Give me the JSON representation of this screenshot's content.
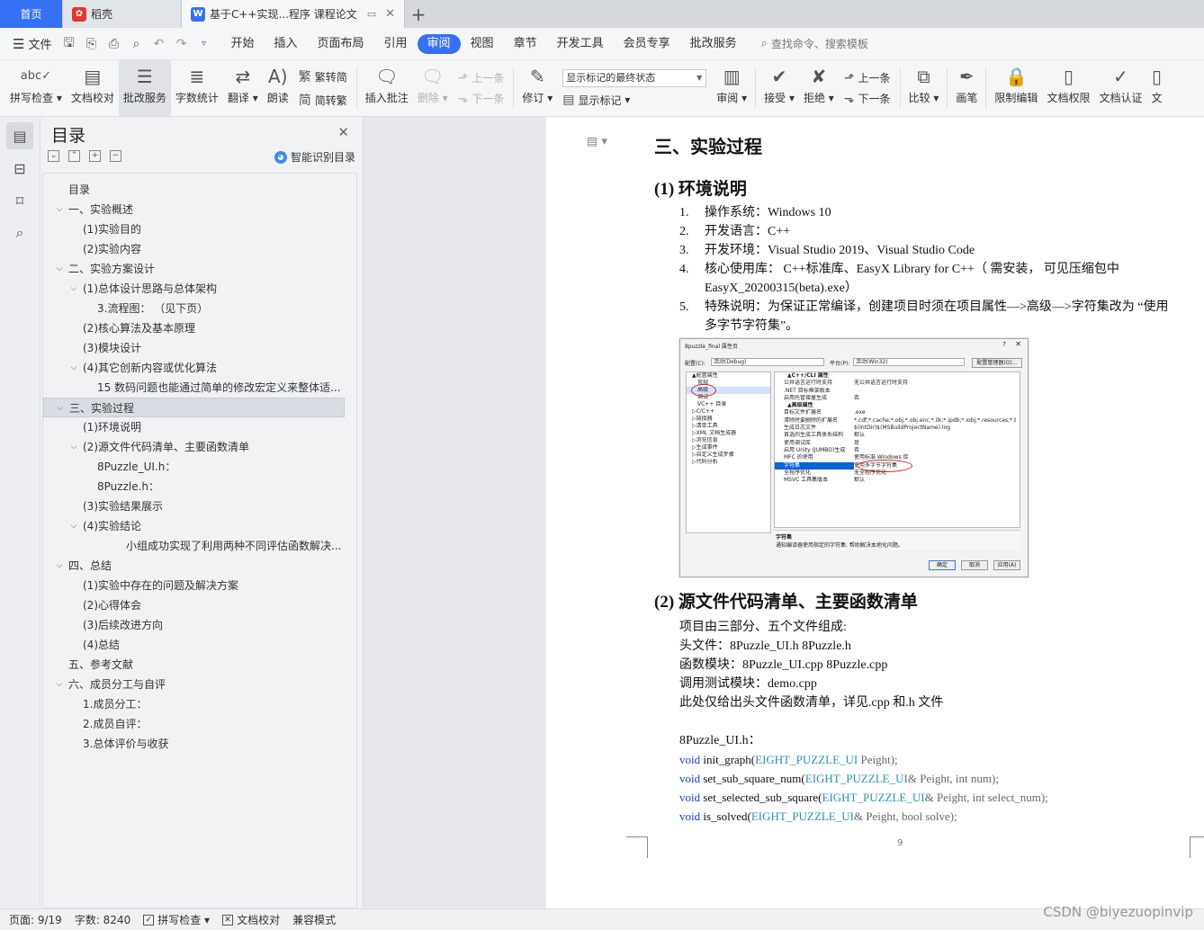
{
  "tabs": {
    "home": "首页",
    "daoke": "稻壳",
    "doc": "基于C++实现...程序 课程论文"
  },
  "menu": {
    "file": "文件",
    "tabs": [
      "开始",
      "插入",
      "页面布局",
      "引用",
      "审阅",
      "视图",
      "章节",
      "开发工具",
      "会员专享",
      "批改服务"
    ],
    "active_tab": "审阅",
    "search": "查找命令、搜索模板"
  },
  "ribbon": {
    "spell": "拼写检查",
    "doccheck": "文档校对",
    "correct": "批改服务",
    "wordcount": "字数统计",
    "translate": "翻译",
    "read": "朗读",
    "trad": "繁转简",
    "simp": "简转繁",
    "insert_comment": "插入批注",
    "delete": "删除",
    "prev": "上一条",
    "next": "下一条",
    "revise": "修订",
    "markup_state": "显示标记的最终状态",
    "show_markup": "显示标记",
    "review": "审阅",
    "accept": "接受",
    "reject": "拒绝",
    "prev2": "上一条",
    "next2": "下一条",
    "compare": "比较",
    "pen": "画笔",
    "restrict": "限制编辑",
    "rights": "文档权限",
    "auth": "文档认证",
    "more": "文"
  },
  "toc": {
    "title": "目录",
    "smart": "智能识别目录",
    "items": [
      {
        "text": "目录",
        "level": 0,
        "chev": ""
      },
      {
        "text": "一、实验概述",
        "level": 0,
        "chev": "v"
      },
      {
        "text": "(1)实验目的",
        "level": 1,
        "chev": ""
      },
      {
        "text": "(2)实验内容",
        "level": 1,
        "chev": ""
      },
      {
        "text": "二、实验方案设计",
        "level": 0,
        "chev": "v"
      },
      {
        "text": "(1)总体设计思路与总体架构",
        "level": 1,
        "chev": "v"
      },
      {
        "text": "3.流程图： （见下页）",
        "level": 2,
        "chev": ""
      },
      {
        "text": "(2)核心算法及基本原理",
        "level": 1,
        "chev": ""
      },
      {
        "text": "(3)模块设计",
        "level": 1,
        "chev": ""
      },
      {
        "text": "(4)其它创新内容或优化算法",
        "level": 1,
        "chev": "v"
      },
      {
        "text": "15 数码问题也能通过简单的修改宏定义来整体适...",
        "level": 2,
        "chev": ""
      },
      {
        "text": "三、实验过程",
        "level": 0,
        "chev": "v",
        "hl": true
      },
      {
        "text": "(1)环境说明",
        "level": 1,
        "chev": ""
      },
      {
        "text": "(2)源文件代码清单、主要函数清单",
        "level": 1,
        "chev": "v"
      },
      {
        "text": "8Puzzle_UI.h：",
        "level": 2,
        "chev": ""
      },
      {
        "text": "8Puzzle.h：",
        "level": 2,
        "chev": ""
      },
      {
        "text": "(3)实验结果展示",
        "level": 1,
        "chev": ""
      },
      {
        "text": "(4)实验结论",
        "level": 1,
        "chev": "v"
      },
      {
        "text": "小组成功实现了利用两种不同评估函数解决...",
        "level": 3,
        "chev": ""
      },
      {
        "text": "四、总结",
        "level": 0,
        "chev": "v"
      },
      {
        "text": "(1)实验中存在的问题及解决方案",
        "level": 1,
        "chev": ""
      },
      {
        "text": "(2)心得体会",
        "level": 1,
        "chev": ""
      },
      {
        "text": "(3)后续改进方向",
        "level": 1,
        "chev": ""
      },
      {
        "text": "(4)总结",
        "level": 1,
        "chev": ""
      },
      {
        "text": "五、参考文献",
        "level": 0,
        "chev": ""
      },
      {
        "text": "六、成员分工与自评",
        "level": 0,
        "chev": "v"
      },
      {
        "text": "1.成员分工：",
        "level": 1,
        "chev": ""
      },
      {
        "text": "2.成员自评：",
        "level": 1,
        "chev": ""
      },
      {
        "text": "3.总体评价与收获",
        "level": 1,
        "chev": ""
      }
    ]
  },
  "doc": {
    "h1": "三、实验过程",
    "h2a": "(1)  环境说明",
    "env": [
      {
        "n": "1.",
        "t": "操作系统：Windows 10"
      },
      {
        "n": "2.",
        "t": "开发语言：C++"
      },
      {
        "n": "3.",
        "t": "开发环境：Visual Studio 2019、Visual Studio Code"
      },
      {
        "n": "4.",
        "t": "核心使用库： C++标准库、EasyX Library for C++（ 需安装， 可见压缩包中 EasyX_20200315(beta).exe）"
      },
      {
        "n": "5.",
        "t": "特殊说明：为保证正常编译，创建项目时须在项目属性—>高级—>字符集改为 “使用多字节字符集”。"
      }
    ],
    "h2b": "(2)  源文件代码清单、主要函数清单",
    "para": [
      "项目由三部分、五个文件组成:",
      "头文件：8Puzzle_UI.h      8Puzzle.h",
      "函数模块：8Puzzle_UI.cpp      8Puzzle.cpp",
      "调用测试模块：demo.cpp",
      "此处仅给出头文件函数清单，详见.cpp 和.h 文件"
    ],
    "code_header": "8Puzzle_UI.h：",
    "code": [
      {
        "kw": "void",
        "fn": " init_graph(",
        "ty": "EIGHT_PUZZLE_UI",
        "rest": " Peight);"
      },
      {
        "kw": "void",
        "fn": " set_sub_square_num(",
        "ty": "EIGHT_PUZZLE_UI",
        "rest": "& Peight, int num);"
      },
      {
        "kw": "void",
        "fn": " set_selected_sub_square(",
        "ty": "EIGHT_PUZZLE_UI",
        "rest": "& Peight, int select_num);"
      },
      {
        "kw": "void",
        "fn": " is_solved(",
        "ty": "EIGHT_PUZZLE_UI",
        "rest": "& Peight, bool solve);"
      }
    ],
    "page_number": "9"
  },
  "dialog": {
    "title": "8puzzle_final 属性页",
    "config_label": "配置(C):",
    "config_value": "活动(Debug)",
    "platform_label": "平台(P):",
    "platform_value": "活动(Win32)",
    "manager_btn": "配置管理器(O)...",
    "tree": [
      "▲配置属性",
      "常规",
      "高级",
      "调试",
      "VC++ 目录",
      "▷C/C++",
      "▷链接器",
      "▷清单工具",
      "▷XML 文档生成器",
      "▷浏览信息",
      "▷生成事件",
      "▷自定义生成步骤",
      "▷代码分析"
    ],
    "rows": [
      {
        "k": "▲C++/CLI 属性",
        "v": "",
        "sec": true
      },
      {
        "k": "公共语言运行时支持",
        "v": "无公共语言运行时支持"
      },
      {
        "k": ".NET 目标框架版本",
        "v": ""
      },
      {
        "k": "启用托管增量生成",
        "v": "否"
      },
      {
        "k": "▲高级属性",
        "v": "",
        "sec": true
      },
      {
        "k": "目标文件扩展名",
        "v": ".exe"
      },
      {
        "k": "清除时要删除的扩展名",
        "v": "*.cdf;*.cache;*.obj;*.obj.enc;*.ilk;*.ipdb;*.iobj;*.resources;*.tlb;*.tli"
      },
      {
        "k": "生成日志文件",
        "v": "$(IntDir)$(MSBuildProjectName).log"
      },
      {
        "k": "首选的生成工具体系结构",
        "v": "默认"
      },
      {
        "k": "使用调试库",
        "v": "是"
      },
      {
        "k": "启用 Unity (JUMBO)生成",
        "v": "否"
      },
      {
        "k": "MFC 的使用",
        "v": "使用标准 Windows 库"
      },
      {
        "k": "字符集",
        "v": "使用多字节字符集",
        "sel": true
      },
      {
        "k": "全程序优化",
        "v": "无全程序优化"
      },
      {
        "k": "MSVC 工具集版本",
        "v": "默认"
      }
    ],
    "desc_title": "字符集",
    "desc_text": "通知编译器使用指定的字符集; 帮助解决本地化问题。",
    "ok": "确定",
    "cancel": "取消",
    "apply": "应用(A)"
  },
  "status": {
    "page": "页面: 9/19",
    "words": "字数: 8240",
    "spell": "拼写检查",
    "check": "文档校对",
    "compat": "兼容模式"
  },
  "watermark": "CSDN @biyezuopinvip"
}
